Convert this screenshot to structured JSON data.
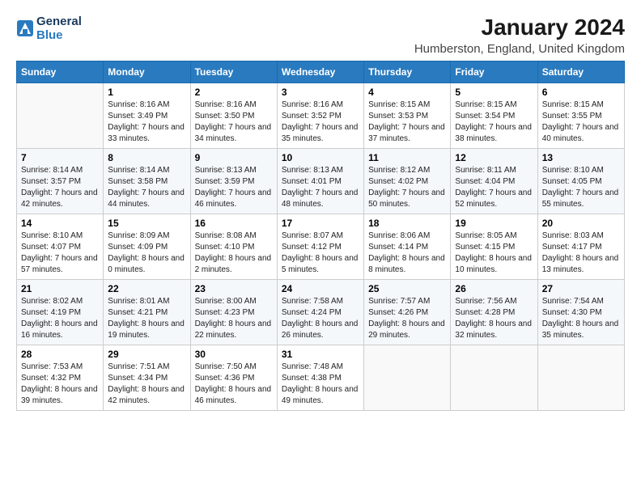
{
  "logo": {
    "line1": "General",
    "line2": "Blue"
  },
  "title": "January 2024",
  "subtitle": "Humberston, England, United Kingdom",
  "days": [
    "Sunday",
    "Monday",
    "Tuesday",
    "Wednesday",
    "Thursday",
    "Friday",
    "Saturday"
  ],
  "weeks": [
    [
      {
        "date": "",
        "sunrise": "",
        "sunset": "",
        "daylight": ""
      },
      {
        "date": "1",
        "sunrise": "Sunrise: 8:16 AM",
        "sunset": "Sunset: 3:49 PM",
        "daylight": "Daylight: 7 hours and 33 minutes."
      },
      {
        "date": "2",
        "sunrise": "Sunrise: 8:16 AM",
        "sunset": "Sunset: 3:50 PM",
        "daylight": "Daylight: 7 hours and 34 minutes."
      },
      {
        "date": "3",
        "sunrise": "Sunrise: 8:16 AM",
        "sunset": "Sunset: 3:52 PM",
        "daylight": "Daylight: 7 hours and 35 minutes."
      },
      {
        "date": "4",
        "sunrise": "Sunrise: 8:15 AM",
        "sunset": "Sunset: 3:53 PM",
        "daylight": "Daylight: 7 hours and 37 minutes."
      },
      {
        "date": "5",
        "sunrise": "Sunrise: 8:15 AM",
        "sunset": "Sunset: 3:54 PM",
        "daylight": "Daylight: 7 hours and 38 minutes."
      },
      {
        "date": "6",
        "sunrise": "Sunrise: 8:15 AM",
        "sunset": "Sunset: 3:55 PM",
        "daylight": "Daylight: 7 hours and 40 minutes."
      }
    ],
    [
      {
        "date": "7",
        "sunrise": "Sunrise: 8:14 AM",
        "sunset": "Sunset: 3:57 PM",
        "daylight": "Daylight: 7 hours and 42 minutes."
      },
      {
        "date": "8",
        "sunrise": "Sunrise: 8:14 AM",
        "sunset": "Sunset: 3:58 PM",
        "daylight": "Daylight: 7 hours and 44 minutes."
      },
      {
        "date": "9",
        "sunrise": "Sunrise: 8:13 AM",
        "sunset": "Sunset: 3:59 PM",
        "daylight": "Daylight: 7 hours and 46 minutes."
      },
      {
        "date": "10",
        "sunrise": "Sunrise: 8:13 AM",
        "sunset": "Sunset: 4:01 PM",
        "daylight": "Daylight: 7 hours and 48 minutes."
      },
      {
        "date": "11",
        "sunrise": "Sunrise: 8:12 AM",
        "sunset": "Sunset: 4:02 PM",
        "daylight": "Daylight: 7 hours and 50 minutes."
      },
      {
        "date": "12",
        "sunrise": "Sunrise: 8:11 AM",
        "sunset": "Sunset: 4:04 PM",
        "daylight": "Daylight: 7 hours and 52 minutes."
      },
      {
        "date": "13",
        "sunrise": "Sunrise: 8:10 AM",
        "sunset": "Sunset: 4:05 PM",
        "daylight": "Daylight: 7 hours and 55 minutes."
      }
    ],
    [
      {
        "date": "14",
        "sunrise": "Sunrise: 8:10 AM",
        "sunset": "Sunset: 4:07 PM",
        "daylight": "Daylight: 7 hours and 57 minutes."
      },
      {
        "date": "15",
        "sunrise": "Sunrise: 8:09 AM",
        "sunset": "Sunset: 4:09 PM",
        "daylight": "Daylight: 8 hours and 0 minutes."
      },
      {
        "date": "16",
        "sunrise": "Sunrise: 8:08 AM",
        "sunset": "Sunset: 4:10 PM",
        "daylight": "Daylight: 8 hours and 2 minutes."
      },
      {
        "date": "17",
        "sunrise": "Sunrise: 8:07 AM",
        "sunset": "Sunset: 4:12 PM",
        "daylight": "Daylight: 8 hours and 5 minutes."
      },
      {
        "date": "18",
        "sunrise": "Sunrise: 8:06 AM",
        "sunset": "Sunset: 4:14 PM",
        "daylight": "Daylight: 8 hours and 8 minutes."
      },
      {
        "date": "19",
        "sunrise": "Sunrise: 8:05 AM",
        "sunset": "Sunset: 4:15 PM",
        "daylight": "Daylight: 8 hours and 10 minutes."
      },
      {
        "date": "20",
        "sunrise": "Sunrise: 8:03 AM",
        "sunset": "Sunset: 4:17 PM",
        "daylight": "Daylight: 8 hours and 13 minutes."
      }
    ],
    [
      {
        "date": "21",
        "sunrise": "Sunrise: 8:02 AM",
        "sunset": "Sunset: 4:19 PM",
        "daylight": "Daylight: 8 hours and 16 minutes."
      },
      {
        "date": "22",
        "sunrise": "Sunrise: 8:01 AM",
        "sunset": "Sunset: 4:21 PM",
        "daylight": "Daylight: 8 hours and 19 minutes."
      },
      {
        "date": "23",
        "sunrise": "Sunrise: 8:00 AM",
        "sunset": "Sunset: 4:23 PM",
        "daylight": "Daylight: 8 hours and 22 minutes."
      },
      {
        "date": "24",
        "sunrise": "Sunrise: 7:58 AM",
        "sunset": "Sunset: 4:24 PM",
        "daylight": "Daylight: 8 hours and 26 minutes."
      },
      {
        "date": "25",
        "sunrise": "Sunrise: 7:57 AM",
        "sunset": "Sunset: 4:26 PM",
        "daylight": "Daylight: 8 hours and 29 minutes."
      },
      {
        "date": "26",
        "sunrise": "Sunrise: 7:56 AM",
        "sunset": "Sunset: 4:28 PM",
        "daylight": "Daylight: 8 hours and 32 minutes."
      },
      {
        "date": "27",
        "sunrise": "Sunrise: 7:54 AM",
        "sunset": "Sunset: 4:30 PM",
        "daylight": "Daylight: 8 hours and 35 minutes."
      }
    ],
    [
      {
        "date": "28",
        "sunrise": "Sunrise: 7:53 AM",
        "sunset": "Sunset: 4:32 PM",
        "daylight": "Daylight: 8 hours and 39 minutes."
      },
      {
        "date": "29",
        "sunrise": "Sunrise: 7:51 AM",
        "sunset": "Sunset: 4:34 PM",
        "daylight": "Daylight: 8 hours and 42 minutes."
      },
      {
        "date": "30",
        "sunrise": "Sunrise: 7:50 AM",
        "sunset": "Sunset: 4:36 PM",
        "daylight": "Daylight: 8 hours and 46 minutes."
      },
      {
        "date": "31",
        "sunrise": "Sunrise: 7:48 AM",
        "sunset": "Sunset: 4:38 PM",
        "daylight": "Daylight: 8 hours and 49 minutes."
      },
      {
        "date": "",
        "sunrise": "",
        "sunset": "",
        "daylight": ""
      },
      {
        "date": "",
        "sunrise": "",
        "sunset": "",
        "daylight": ""
      },
      {
        "date": "",
        "sunrise": "",
        "sunset": "",
        "daylight": ""
      }
    ]
  ]
}
